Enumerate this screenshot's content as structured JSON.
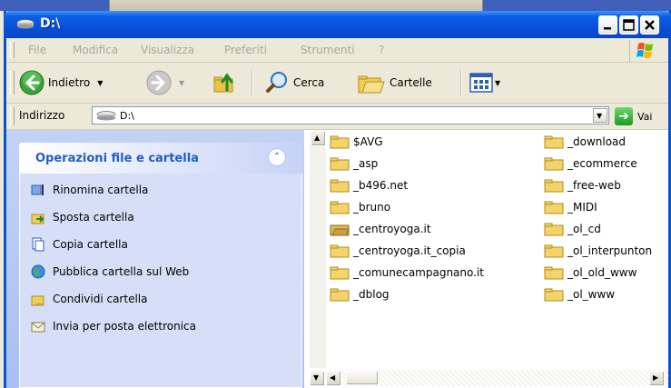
{
  "window": {
    "title": "D:\\"
  },
  "menu": [
    "File",
    "Modifica",
    "Visualizza",
    "Preferiti",
    "Strumenti",
    "?"
  ],
  "toolbar": {
    "back_label": "Indietro",
    "search_label": "Cerca",
    "folders_label": "Cartelle"
  },
  "address": {
    "label": "Indirizzo",
    "value": "D:\\",
    "go_label": "Vai"
  },
  "tasks": {
    "title": "Operazioni file e cartella",
    "items": [
      "Rinomina cartella",
      "Sposta cartella",
      "Copia cartella",
      "Pubblica cartella sul Web",
      "Condividi cartella",
      "Invia per posta elettronica"
    ]
  },
  "files": {
    "column1": [
      "$AVG",
      "_asp",
      "_b496.net",
      "_bruno",
      "_centroyoga.it",
      "_centroyoga.it_copia",
      "_comunecampagnano.it",
      "_dblog"
    ],
    "column2": [
      "_download",
      "_ecommerce",
      "_free-web",
      "_MIDI",
      "_ol_cd",
      "_ol_interpunton",
      "_ol_old_www",
      "_ol_www"
    ]
  },
  "colors": {
    "titlebar": "#0a5ee6",
    "task_pane": "#a9bfef",
    "task_title": "#215dc6",
    "folder": "#f3d36a"
  }
}
